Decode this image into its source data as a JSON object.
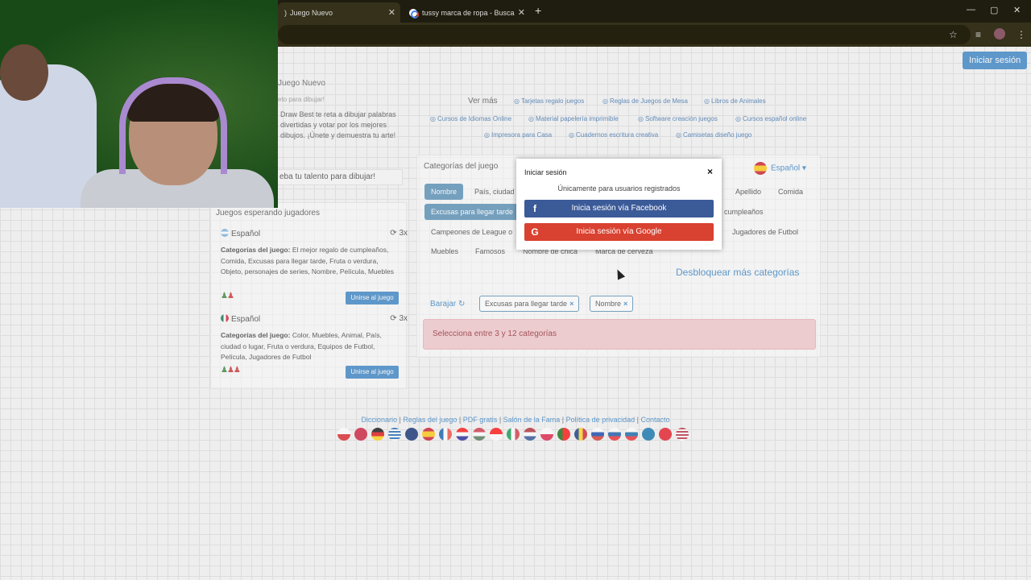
{
  "browser": {
    "tabs": [
      {
        "label": "Juego Nuevo"
      },
      {
        "label": "tussy marca de ropa - Buscar c"
      }
    ],
    "new_tab": "+",
    "win_min": "—",
    "win_max": "▢",
    "win_close": "✕",
    "icons": [
      "star-icon",
      "playlist-icon",
      "profile-icon",
      "menu-icon"
    ]
  },
  "header": {
    "login_button": "Iniciar sesión"
  },
  "left": {
    "title": "Juego Nuevo",
    "subtitle": "eto para dibujar!",
    "description": "Draw Best te reta a dibujar palabras divertidas y votar por los mejores dibujos. ¡Únete y demuestra tu arte!",
    "try_button": "eba tu talento para dibujar!"
  },
  "vermas": {
    "label": "Ver más",
    "chips": [
      "Tarjetas regalo juegos",
      "Reglas de Juegos de Mesa",
      "Libros de Animales",
      "Cursos de Idiomas Online",
      "Material papelería imprimible",
      "Software creación juegos",
      "Cursos español online",
      "Impresora para Casa",
      "Cuadernos escritura creativa",
      "Camisetas diseño juego"
    ]
  },
  "categories": {
    "title": "Categorías del juego",
    "language": "Español",
    "items": [
      "Nombre",
      "País, ciudad",
      "Apellido",
      "Comida",
      "Excusas para llegar tarde",
      "cumpleaños",
      "Campeones de League o",
      "Jugadores de Futbol",
      "Muebles",
      "Famosos",
      "Nombre de chica",
      "Marca de cerveza"
    ],
    "unlock": "Desbloquear más categorías",
    "shuffle": "Barajar",
    "selected": [
      "Excusas para llegar tarde",
      "Nombre"
    ],
    "alert": "Selecciona entre 3 y 12 categorías"
  },
  "games": {
    "title": "Juegos esperando jugadores",
    "list": [
      {
        "language": "Español",
        "count": "3x",
        "label": "Categorías del juego:",
        "cats": "El mejor regalo de cumpleaños, Comida, Excusas para llegar tarde, Fruta o verdura, Objeto, personajes de series, Nombre, Película, Muebles",
        "join": "Unirse al juego"
      },
      {
        "language": "Español",
        "count": "3x",
        "label": "Categorías del juego:",
        "cats": "Color, Muebles, Animal, País, ciudad o lugar, Fruta o verdura, Equipos de Futbol, Película, Jugadores de Futbol",
        "join": "Unirse al juego"
      }
    ]
  },
  "footer": {
    "links": [
      "Diccionario",
      "Reglas del juego",
      "PDF gratis",
      "Salón de la Fama",
      "Política de privacidad",
      "Contacto"
    ],
    "separator": "|"
  },
  "modal": {
    "title": "Iniciar sesión",
    "close": "×",
    "subtitle": "Únicamente para usuarios registrados",
    "facebook": "Inicia sesión vía Facebook",
    "google": "Inicia sesión vía Google"
  },
  "colors": {
    "accent": "#2b7bc0",
    "facebook": "#3b5a98",
    "google": "#d94130",
    "alert_bg": "#f1c4c8",
    "alert_text": "#8a1c24"
  }
}
